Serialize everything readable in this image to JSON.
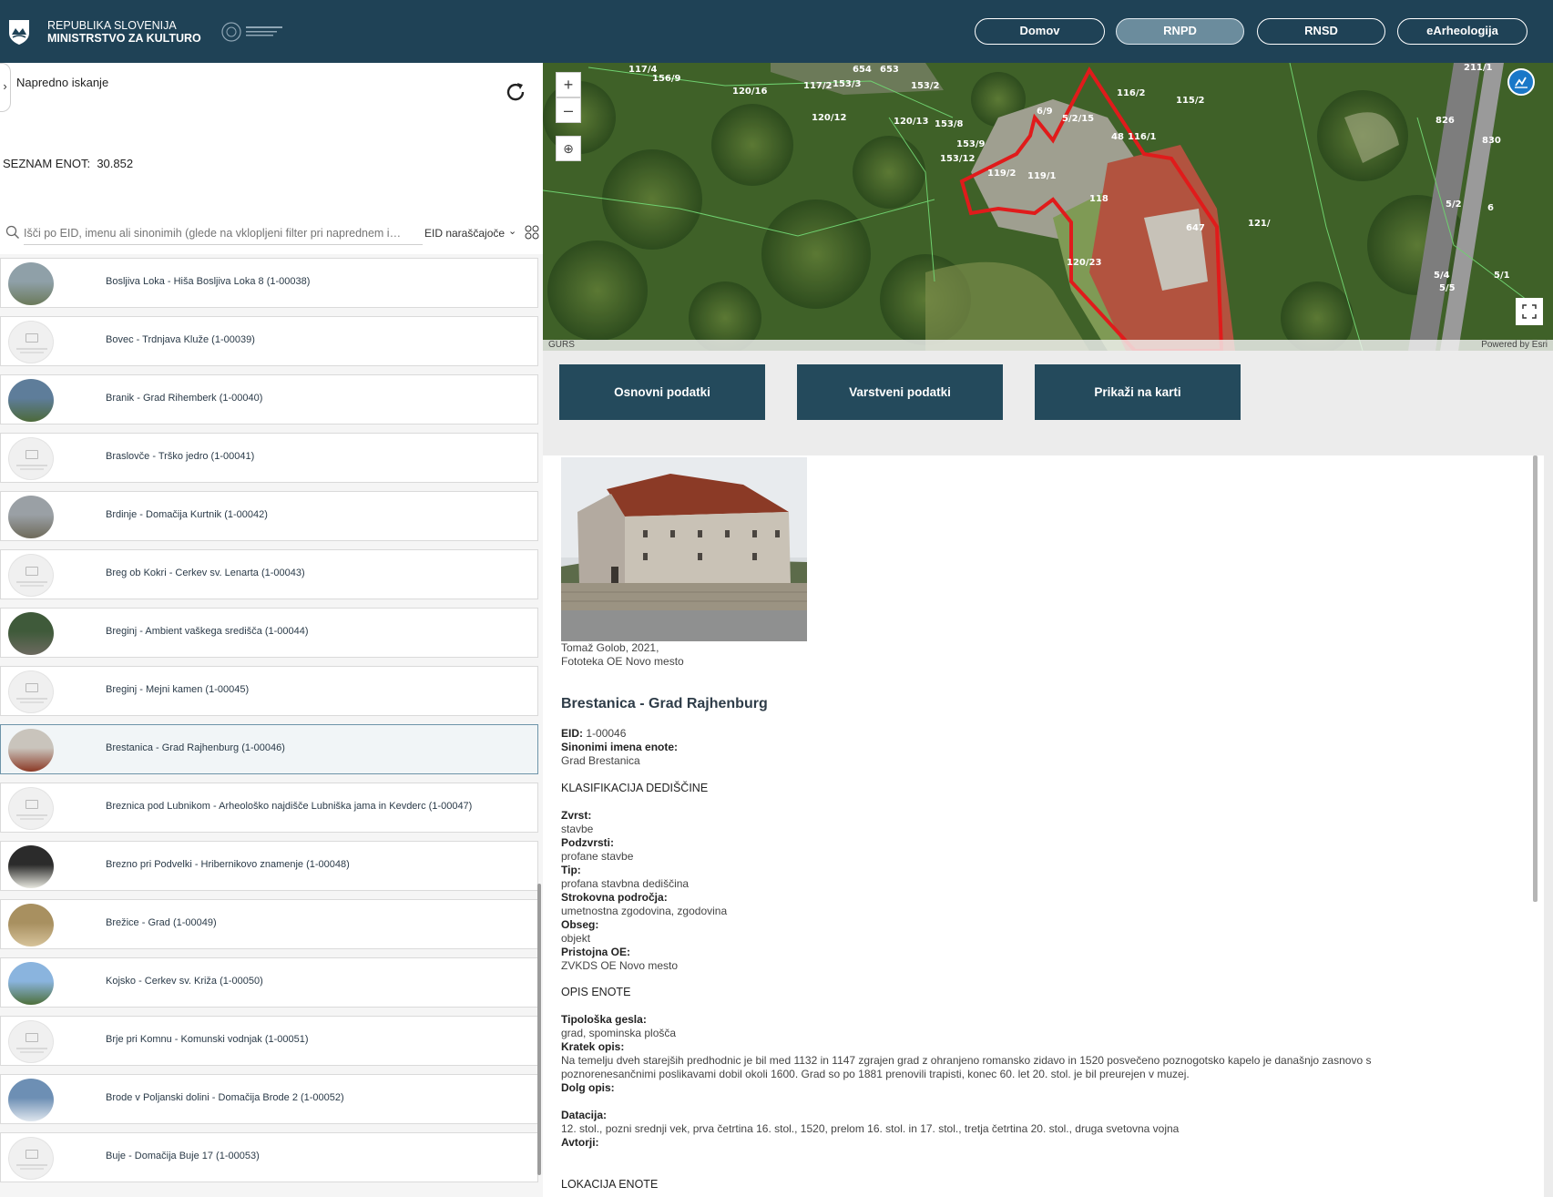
{
  "header": {
    "gov_line1": "REPUBLIKA SLOVENIJA",
    "gov_line2": "MINISTRSTVO ZA KULTURO",
    "nav": [
      "Domov",
      "RNPD",
      "RNSD",
      "eArheologija"
    ]
  },
  "left": {
    "advanced_search": "Napredno iskanje",
    "count_label": "SEZNAM ENOT:",
    "count_value": "30.852",
    "search_placeholder": "Išči po EID, imenu ali sinonimih (glede na vklopljeni filter pri naprednem i…",
    "sort_label": "EID naraščajoče",
    "items": [
      {
        "label": "Bosljiva Loka - Hiša Bosljiva Loka 8  (1-00038)",
        "thumb": "photo-house"
      },
      {
        "label": "Bovec - Trdnjava Kluže  (1-00039)",
        "thumb": "placeholder"
      },
      {
        "label": "Branik - Grad Rihemberk  (1-00040)",
        "thumb": "photo-castle"
      },
      {
        "label": "Braslovče - Trško jedro  (1-00041)",
        "thumb": "placeholder"
      },
      {
        "label": "Brdinje - Domačija Kurtnik  (1-00042)",
        "thumb": "photo-farm"
      },
      {
        "label": "Breg ob Kokri - Cerkev sv. Lenarta  (1-00043)",
        "thumb": "placeholder"
      },
      {
        "label": "Breginj - Ambient vaškega središča  (1-00044)",
        "thumb": "photo-village"
      },
      {
        "label": "Breginj - Mejni kamen  (1-00045)",
        "thumb": "placeholder"
      },
      {
        "label": "Brestanica - Grad Rajhenburg  (1-00046)",
        "thumb": "photo-rajhenburg",
        "selected": true
      },
      {
        "label": "Breznica pod Lubnikom - Arheološko najdišče Lubniška jama in Kevderc  (1-00047)",
        "thumb": "placeholder"
      },
      {
        "label": "Brezno pri Podvelki - Hribernikovo znamenje  (1-00048)",
        "thumb": "photo-shrine"
      },
      {
        "label": "Brežice - Grad  (1-00049)",
        "thumb": "photo-fresco"
      },
      {
        "label": "Kojsko - Cerkev sv. Križa  (1-00050)",
        "thumb": "photo-church"
      },
      {
        "label": "Brje pri Komnu - Komunski vodnjak  (1-00051)",
        "thumb": "placeholder"
      },
      {
        "label": "Brode v Poljanski dolini - Domačija Brode 2  (1-00052)",
        "thumb": "photo-sky"
      },
      {
        "label": "Buje - Domačija Buje 17  (1-00053)",
        "thumb": "placeholder"
      }
    ]
  },
  "map": {
    "attribution_left": "GURS",
    "attribution_right": "Powered by Esri",
    "parcels": [
      "117/4",
      "156/9",
      "120/16",
      "117/2",
      "153/3",
      "654",
      "653",
      "153/2",
      "116/2",
      "115/2",
      "211/1",
      "120/12",
      "120/13",
      "153/8",
      "6/9",
      "5/2/15",
      "48",
      "116/1",
      "153/9",
      "153/12",
      "119/2",
      "119/1",
      "118",
      "647",
      "121/",
      "120/23",
      "826",
      "830",
      "5/2",
      "6",
      "5/4",
      "5/5",
      "5/1"
    ]
  },
  "actions": [
    "Osnovni podatki",
    "Varstveni podatki",
    "Prikaži na karti"
  ],
  "detail": {
    "caption_1": "Tomaž Golob, 2021,",
    "caption_2": "Fototeka OE Novo mesto",
    "title": "Brestanica - Grad Rajhenburg",
    "eid_label": "EID:",
    "eid": "1-00046",
    "synonyms_label": "Sinonimi imena enote:",
    "synonyms": "Grad Brestanica",
    "section_classification": "KLASIFIKACIJA DEDIŠČINE",
    "zvrst_label": "Zvrst:",
    "zvrst": "stavbe",
    "podzvrsti_label": "Podzvrsti:",
    "podzvrsti": "profane stavbe",
    "tip_label": "Tip:",
    "tip": "profana stavbna dediščina",
    "strokovna_label": "Strokovna področja:",
    "strokovna": "umetnostna zgodovina, zgodovina",
    "obseg_label": "Obseg:",
    "obseg": "objekt",
    "pristojna_label": "Pristojna OE:",
    "pristojna": "ZVKDS OE Novo mesto",
    "section_description": "OPIS ENOTE",
    "tipoloska_label": "Tipološka gesla:",
    "tipoloska": "grad, spominska plošča",
    "kratek_label": "Kratek opis:",
    "kratek_1": "Na temelju dveh starejših predhodnic je bil med 1132 in 1147 zgrajen grad z ohranjeno romansko zidavo in 1520 posvečeno poznogotsko kapelo je današnjo zasnovo s",
    "kratek_2": "poznorenesančnimi poslikavami dobil okoli 1600. Grad so po 1881 prenovili trapisti, konec 60. let 20. stol. je bil preurejen v muzej.",
    "dolg_label": "Dolg opis:",
    "datacija_label": "Datacija:",
    "datacija": "12. stol., pozni srednji vek, prva četrtina 16. stol., 1520, prelom 16. stol. in 17. stol., tretja četrtina 20. stol., druga svetovna vojna",
    "avtorji_label": "Avtorji:",
    "section_location": "LOKACIJA ENOTE"
  },
  "colors": {
    "header_bg": "#1f4256",
    "button_bg": "#244a5c",
    "nav_active": "#6b8c9d",
    "map_outline": "#e01b1b"
  }
}
